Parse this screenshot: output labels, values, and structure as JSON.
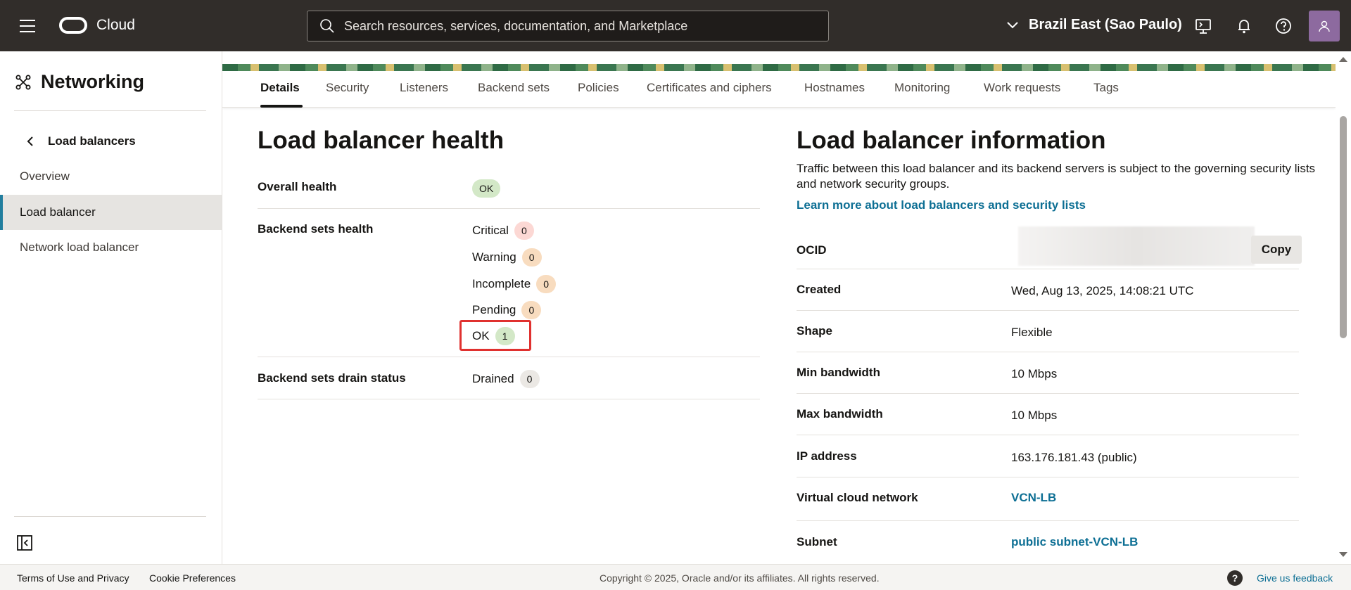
{
  "header": {
    "brand": "Cloud",
    "search_placeholder": "Search resources, services, documentation, and Marketplace",
    "region": "Brazil East (Sao Paulo)"
  },
  "sidebar": {
    "title": "Networking",
    "back_label": "Load balancers",
    "items": [
      {
        "label": "Overview",
        "active": false
      },
      {
        "label": "Load balancer",
        "active": true
      },
      {
        "label": "Network load balancer",
        "active": false
      }
    ]
  },
  "tabs": [
    {
      "label": "Details",
      "active": true
    },
    {
      "label": "Security"
    },
    {
      "label": "Listeners"
    },
    {
      "label": "Backend sets"
    },
    {
      "label": "Policies"
    },
    {
      "label": "Certificates and ciphers"
    },
    {
      "label": "Hostnames"
    },
    {
      "label": "Monitoring"
    },
    {
      "label": "Work requests"
    },
    {
      "label": "Tags"
    }
  ],
  "health": {
    "title": "Load balancer health",
    "overall_label": "Overall health",
    "overall_value": "OK",
    "backend_label": "Backend sets health",
    "statuses": [
      {
        "label": "Critical",
        "count": "0"
      },
      {
        "label": "Warning",
        "count": "0"
      },
      {
        "label": "Incomplete",
        "count": "0"
      },
      {
        "label": "Pending",
        "count": "0"
      },
      {
        "label": "OK",
        "count": "1"
      }
    ],
    "drain_label": "Backend sets drain status",
    "drain_value_label": "Drained",
    "drain_count": "0"
  },
  "info": {
    "title": "Load balancer information",
    "description": "Traffic between this load balancer and its backend servers is subject to the governing security lists and network security groups.",
    "learn_more": "Learn more about load balancers and security lists",
    "ocid_label": "OCID",
    "copy_label": "Copy",
    "rows": [
      {
        "label": "Created",
        "value": "Wed, Aug 13, 2025, 14:08:21 UTC"
      },
      {
        "label": "Shape",
        "value": "Flexible"
      },
      {
        "label": "Min bandwidth",
        "value": "10 Mbps"
      },
      {
        "label": "Max bandwidth",
        "value": "10 Mbps"
      },
      {
        "label": "IP address",
        "value": "163.176.181.43 (public)"
      },
      {
        "label": "Virtual cloud network",
        "value": "VCN-LB"
      },
      {
        "label": "Subnet",
        "value": "public subnet-VCN-LB"
      }
    ]
  },
  "footer": {
    "terms": "Terms of Use and Privacy",
    "cookies": "Cookie Preferences",
    "copyright": "Copyright © 2025, Oracle and/or its affiliates. All rights reserved.",
    "feedback": "Give us feedback"
  }
}
